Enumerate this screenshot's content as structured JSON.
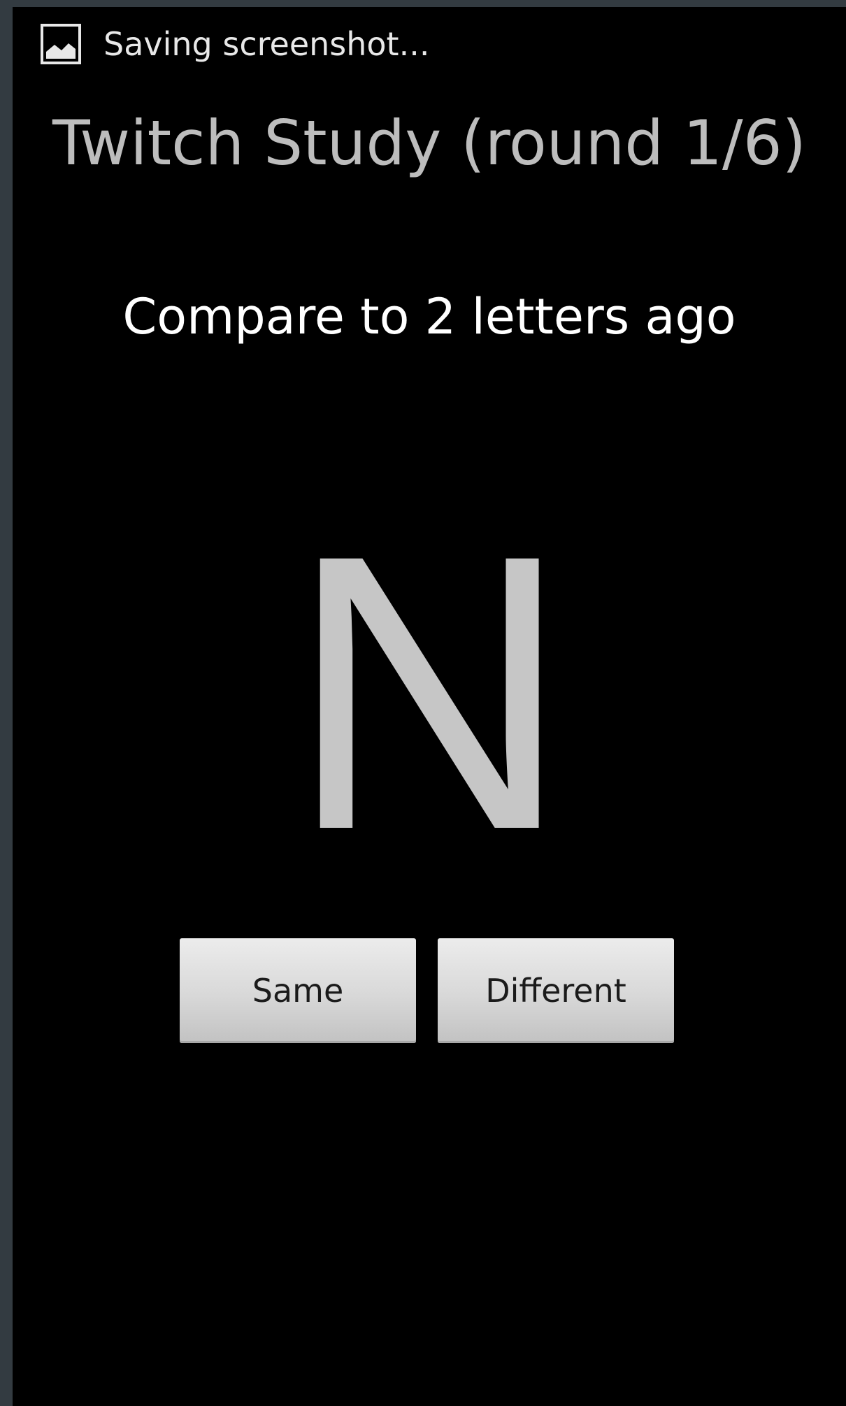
{
  "status_bar": {
    "notification_icon": "image-icon",
    "notification_text": "Saving screenshot..."
  },
  "app": {
    "title": "Twitch Study (round 1/6)",
    "instruction": "Compare to 2 letters ago",
    "current_letter": "N"
  },
  "buttons": {
    "same_label": "Same",
    "different_label": "Different"
  },
  "colors": {
    "background": "#000000",
    "frame": "#333b41",
    "title_text": "#bdbdbd",
    "letter": "#c6c6c6",
    "button_face": "#d8d8d8"
  }
}
